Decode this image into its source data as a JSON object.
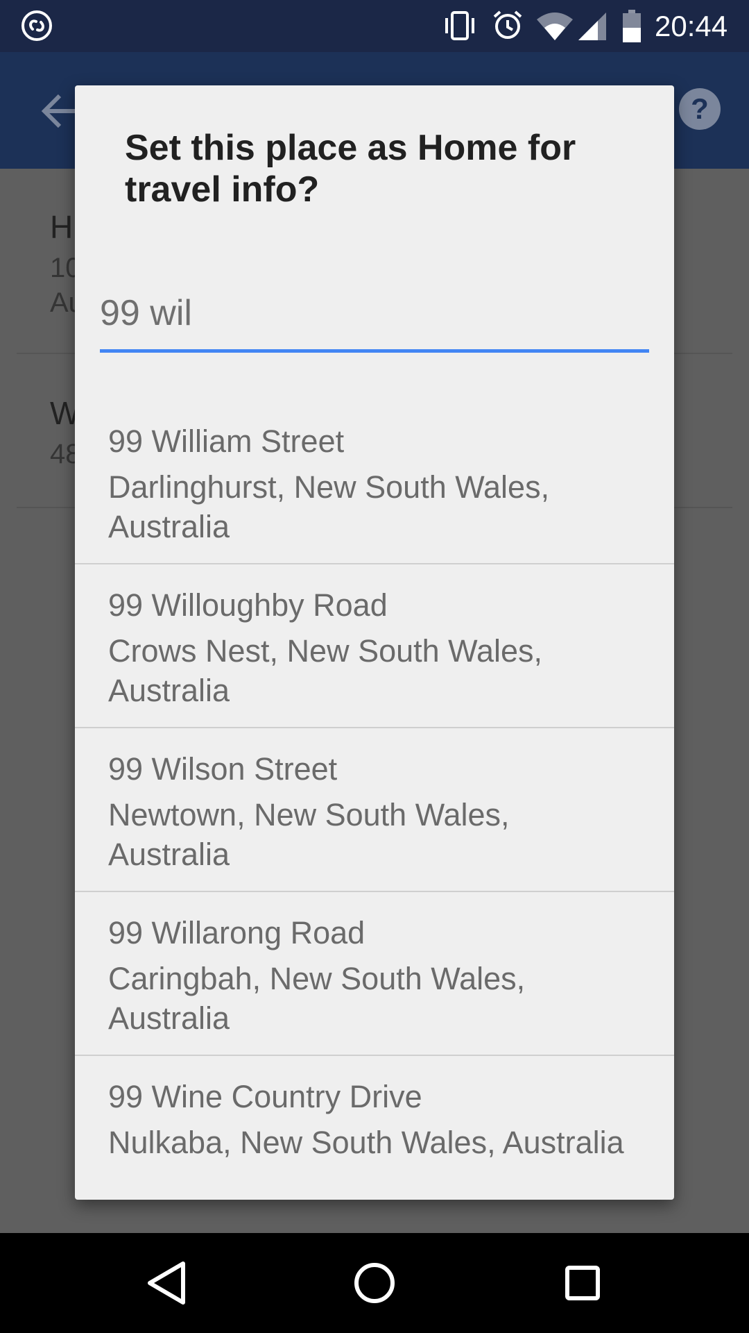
{
  "status_bar": {
    "time": "20:44",
    "icons": [
      "shazam-icon",
      "vibrate-icon",
      "alarm-icon",
      "wifi-icon",
      "signal-icon",
      "battery-icon"
    ]
  },
  "app_bar": {
    "icons": [
      "back-arrow-icon",
      "help-icon"
    ]
  },
  "background_list": {
    "items": [
      {
        "title_visible": "H",
        "line1_visible": "10",
        "line2_visible": "Au"
      },
      {
        "title_visible": "W",
        "line1_visible": "48"
      }
    ]
  },
  "dialog": {
    "title": "Set this place as Home for travel info?",
    "search": {
      "value": "99 wil"
    },
    "results": [
      {
        "name": "99 William Street",
        "address": "Darlinghurst, New South Wales, Australia"
      },
      {
        "name": "99 Willoughby Road",
        "address": "Crows Nest, New South Wales, Australia"
      },
      {
        "name": "99 Wilson Street",
        "address": "Newtown, New South Wales, Australia"
      },
      {
        "name": "99 Willarong Road",
        "address": "Caringbah, New South Wales, Australia"
      },
      {
        "name": "99 Wine Country Drive",
        "address": "Nulkaba, New South Wales, Australia"
      }
    ]
  },
  "nav_bar": {
    "icons": [
      "back-triangle-icon",
      "home-circle-icon",
      "recents-square-icon"
    ]
  },
  "colors": {
    "status_bar": "#1b2747",
    "app_bar_dimmed": "#1c3157",
    "scrim": "#5f5f5f",
    "dialog_bg": "#efefef",
    "accent": "#4285f4"
  }
}
